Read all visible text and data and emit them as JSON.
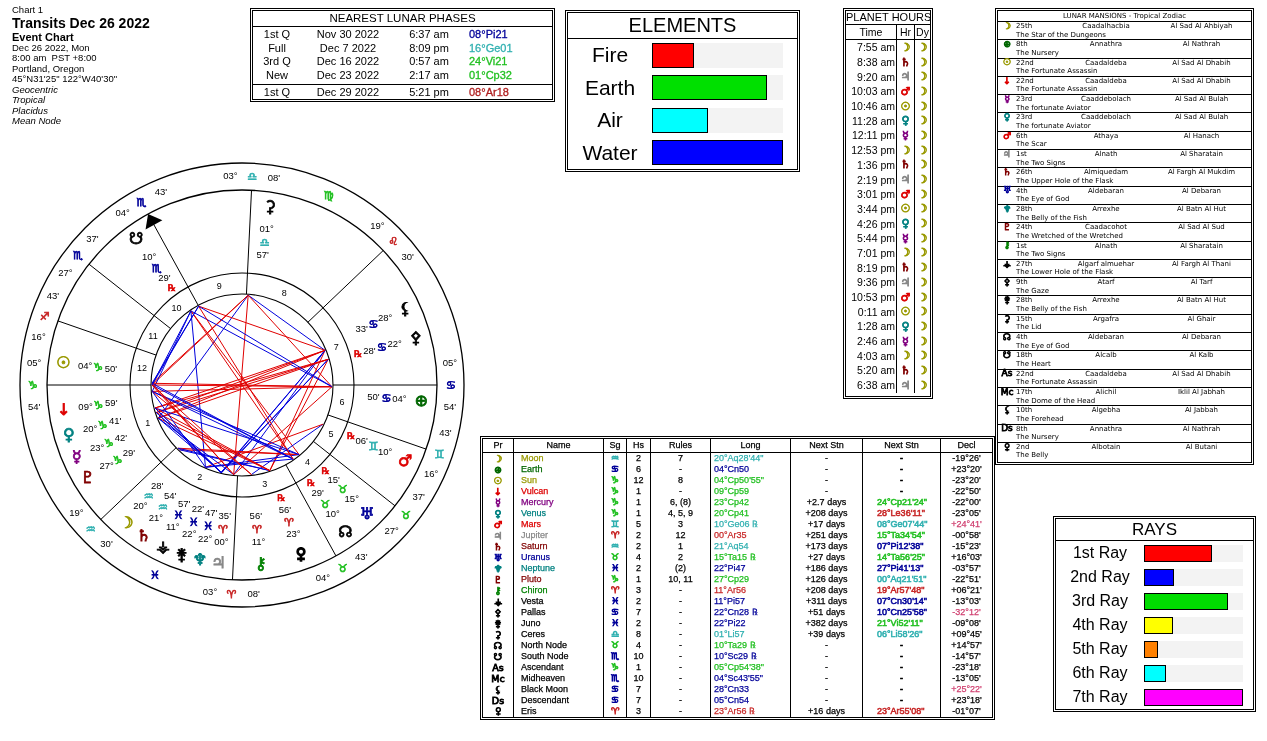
{
  "chart_info": {
    "label": "Chart 1",
    "title": "Transits Dec 26 2022",
    "subtitle": "Event Chart",
    "details": [
      "Dec 26 2022, Mon",
      "8:00 am  PST +8:00",
      "Portland, Oregon",
      "45°N31'25\" 122°W40'30\""
    ],
    "settings": [
      "Geocentric",
      "Tropical",
      "Placidus",
      "Mean Node"
    ]
  },
  "lunar_phases": {
    "title": "NEAREST LUNAR PHASES",
    "phases": [
      {
        "phase": "1st Q",
        "date": "Nov 30 2022",
        "time": "6:37 am",
        "position": "08°Pi21",
        "color": "#000099"
      },
      {
        "phase": "Full",
        "date": "Dec 7 2022",
        "time": "8:09 pm",
        "position": "16°Ge01",
        "color": "#30b0b0"
      },
      {
        "phase": "3rd Q",
        "date": "Dec 16 2022",
        "time": "0:57 am",
        "position": "24°Vi21",
        "color": "#22c022"
      },
      {
        "phase": "New",
        "date": "Dec 23 2022",
        "time": "2:17 am",
        "position": "01°Cp32",
        "color": "#22c022"
      }
    ],
    "next_phase": {
      "phase": "1st Q",
      "date": "Dec 29 2022",
      "time": "5:21 pm",
      "position": "08°Ar18",
      "color": "#b02020"
    }
  },
  "elements": {
    "title": "ELEMENTS",
    "items": [
      {
        "label": "Fire",
        "level": 0.32,
        "color": "#ff0000"
      },
      {
        "label": "Earth",
        "level": 0.88,
        "color": "#00e000"
      },
      {
        "label": "Air",
        "level": 0.43,
        "color": "#00ffff"
      },
      {
        "label": "Water",
        "level": 1,
        "color": "#0000ff"
      }
    ]
  },
  "planet_hours": {
    "title": "PLANET HOURS",
    "columns": [
      "Time",
      "Hr",
      "Dy"
    ],
    "rows": [
      {
        "time": "7:55 am",
        "symbol": "☽",
        "color": "#999900",
        "day_symbol": "☽"
      },
      {
        "time": "8:38 am",
        "symbol": "♄",
        "color": "#800000",
        "day_symbol": "☽"
      },
      {
        "time": "9:20 am",
        "symbol": "♃",
        "color": "#888888",
        "day_symbol": "☽"
      },
      {
        "time": "10:03 am",
        "symbol": "♂",
        "color": "#dd0000",
        "day_symbol": "☽"
      },
      {
        "time": "10:46 am",
        "symbol": "☉",
        "color": "#999900",
        "day_symbol": "☽"
      },
      {
        "time": "11:28 am",
        "symbol": "♀",
        "color": "#008080",
        "day_symbol": "☽"
      },
      {
        "time": "12:11 pm",
        "symbol": "☿",
        "color": "#800080",
        "day_symbol": "☽"
      },
      {
        "time": "12:53 pm",
        "symbol": "☽",
        "color": "#999900",
        "day_symbol": "☽"
      },
      {
        "time": "1:36 pm",
        "symbol": "♄",
        "color": "#800000",
        "day_symbol": "☽"
      },
      {
        "time": "2:19 pm",
        "symbol": "♃",
        "color": "#888888",
        "day_symbol": "☽"
      },
      {
        "time": "3:01 pm",
        "symbol": "♂",
        "color": "#dd0000",
        "day_symbol": "☽"
      },
      {
        "time": "3:44 pm",
        "symbol": "☉",
        "color": "#999900",
        "day_symbol": "☽"
      },
      {
        "time": "4:26 pm",
        "symbol": "♀",
        "color": "#008080",
        "day_symbol": "☽"
      },
      {
        "time": "5:44 pm",
        "symbol": "☿",
        "color": "#800080",
        "day_symbol": "☽"
      },
      {
        "time": "7:01 pm",
        "symbol": "☽",
        "color": "#999900",
        "day_symbol": "☽"
      },
      {
        "time": "8:19 pm",
        "symbol": "♄",
        "color": "#800000",
        "day_symbol": "☽"
      },
      {
        "time": "9:36 pm",
        "symbol": "♃",
        "color": "#888888",
        "day_symbol": "☽"
      },
      {
        "time": "10:53 pm",
        "symbol": "♂",
        "color": "#dd0000",
        "day_symbol": "☽"
      },
      {
        "time": "0:11 am",
        "symbol": "☉",
        "color": "#999900",
        "day_symbol": "☽"
      },
      {
        "time": "1:28 am",
        "symbol": "♀",
        "color": "#008080",
        "day_symbol": "☽"
      },
      {
        "time": "2:46 am",
        "symbol": "☿",
        "color": "#800080",
        "day_symbol": "☽"
      },
      {
        "time": "4:03 am",
        "symbol": "☽",
        "color": "#999900",
        "day_symbol": "☽"
      },
      {
        "time": "5:20 am",
        "symbol": "♄",
        "color": "#800000",
        "day_symbol": "☽"
      },
      {
        "time": "6:38 am",
        "symbol": "♃",
        "color": "#888888",
        "day_symbol": "☽"
      }
    ]
  },
  "lunar_mansions": {
    "title": "LUNAR MANSIONS - Tropical Zodiac",
    "rows": [
      {
        "symbol": "☽",
        "color": "#999900",
        "number": "25th",
        "name": "Caadalhacbia",
        "arabic": "Al Sad Al Ahbiyah",
        "meaning": "The Star of the Dungeons"
      },
      {
        "symbol": "⊕",
        "color": "#006600",
        "number": "8th",
        "name": "Annathra",
        "arabic": "Al Nathrah",
        "meaning": "The Nursery"
      },
      {
        "symbol": "☉",
        "color": "#999900",
        "number": "22nd",
        "name": "Caadaldeba",
        "arabic": "Al Sad Al Dhabih",
        "meaning": "The Fortunate Assassin"
      },
      {
        "symbol": "↓",
        "color": "#dd0000",
        "number": "22nd",
        "name": "Caadaldeba",
        "arabic": "Al Sad Al Dhabih",
        "meaning": "The Fortunate Assassin"
      },
      {
        "symbol": "☿",
        "color": "#800080",
        "number": "23rd",
        "name": "Caaddebolach",
        "arabic": "Al Sad Al Bulah",
        "meaning": "The fortunate Aviator"
      },
      {
        "symbol": "♀",
        "color": "#008080",
        "number": "23rd",
        "name": "Caaddebolach",
        "arabic": "Al Sad Al Bulah",
        "meaning": "The fortunate Aviator"
      },
      {
        "symbol": "♂",
        "color": "#dd0000",
        "number": "6th",
        "name": "Athaya",
        "arabic": "Al Hanach",
        "meaning": "The Scar"
      },
      {
        "symbol": "♃",
        "color": "#888888",
        "number": "1st",
        "name": "Alnath",
        "arabic": "Al Sharatain",
        "meaning": "The Two Signs"
      },
      {
        "symbol": "♄",
        "color": "#800000",
        "number": "26th",
        "name": "Almiquedam",
        "arabic": "Al Fargh Al Mukdim",
        "meaning": "The Upper Hole of the Flask"
      },
      {
        "symbol": "♅",
        "color": "#000099",
        "number": "4th",
        "name": "Aldebaran",
        "arabic": "Al Debaran",
        "meaning": "The Eye of God"
      },
      {
        "symbol": "♆",
        "color": "#008080",
        "number": "28th",
        "name": "Arrexhe",
        "arabic": "Al Batn Al Hut",
        "meaning": "The Belly of the Fish"
      },
      {
        "symbol": "♇",
        "color": "#800000",
        "number": "24th",
        "name": "Caadacohot",
        "arabic": "Al Sad Al Sud",
        "meaning": "The Wretched of the Wretched"
      },
      {
        "symbol": "⚷",
        "color": "#008000",
        "number": "1st",
        "name": "Alnath",
        "arabic": "Al Sharatain",
        "meaning": "The Two Signs"
      },
      {
        "symbol": "⚶",
        "color": "#000000",
        "number": "27th",
        "name": "Algarf almuehar",
        "arabic": "Al Fargh Al Thani",
        "meaning": "The Lower Hole of the Flask"
      },
      {
        "symbol": "⚴",
        "color": "#000000",
        "number": "9th",
        "name": "Atarf",
        "arabic": "Al Tarf",
        "meaning": "The Gaze"
      },
      {
        "symbol": "⚵",
        "color": "#000000",
        "number": "28th",
        "name": "Arrexhe",
        "arabic": "Al Batn Al Hut",
        "meaning": "The Belly of the Fish"
      },
      {
        "symbol": "⚳",
        "color": "#000000",
        "number": "15th",
        "name": "Argafra",
        "arabic": "Al Ghair",
        "meaning": "The Lid"
      },
      {
        "symbol": "☊",
        "color": "#000000",
        "number": "4th",
        "name": "Aldebaran",
        "arabic": "Al Debaran",
        "meaning": "The Eye of God"
      },
      {
        "symbol": "☋",
        "color": "#000000",
        "number": "18th",
        "name": "Alcalb",
        "arabic": "Al Kalb",
        "meaning": "The Heart"
      },
      {
        "symbol": "As",
        "color": "#000000",
        "number": "22nd",
        "name": "Caadaldeba",
        "arabic": "Al Sad Al Dhabih",
        "meaning": "The Fortunate Assassin"
      },
      {
        "symbol": "Mc",
        "color": "#000000",
        "number": "17th",
        "name": "Alichil",
        "arabic": "Iklil Al Jabhah",
        "meaning": "The Dome of the Head"
      },
      {
        "symbol": "⚸",
        "color": "#000000",
        "number": "10th",
        "name": "Algebha",
        "arabic": "Al Jabbah",
        "meaning": "The Forehead"
      },
      {
        "symbol": "Ds",
        "color": "#000000",
        "number": "8th",
        "name": "Annathra",
        "arabic": "Al Nathrah",
        "meaning": "The Nursery"
      },
      {
        "color": "#000000",
        "number": "2nd",
        "name": "Albotain",
        "arabic": "Al Butani",
        "meaning": "The Belly"
      }
    ]
  },
  "wheel": {
    "cusps": [
      {
        "degree": "05°",
        "sign": "♑",
        "color": "#22c022",
        "minutes": "54'"
      },
      {
        "degree": "19°",
        "sign": "♒",
        "color": "#30b0b0",
        "minutes": "30'"
      },
      {
        "degree": "03°",
        "sign": "♈",
        "color": "#c82828",
        "minutes": "08'"
      },
      {
        "degree": "04°",
        "sign": "♉",
        "color": "#22c022",
        "minutes": "43'"
      },
      {
        "degree": "27°",
        "sign": "♉",
        "color": "#22c022",
        "minutes": "37'"
      },
      {
        "degree": "16°",
        "sign": "♊",
        "color": "#30b0b0",
        "minutes": "43'"
      },
      {
        "degree": "05°",
        "sign": "♋",
        "color": "#000099",
        "minutes": "54'"
      },
      {
        "degree": "19°",
        "sign": "♌",
        "color": "#c82828",
        "minutes": "30'"
      },
      {
        "degree": "03°",
        "sign": "♎",
        "color": "#30b0b0",
        "minutes": "08'"
      },
      {
        "degree": "04°",
        "sign": "♏",
        "color": "#000099",
        "minutes": "43'"
      },
      {
        "degree": "27°",
        "sign": "♏",
        "color": "#000099",
        "minutes": "37'"
      },
      {
        "degree": "16°",
        "sign": "♐",
        "color": "#c82828",
        "minutes": "43'"
      }
    ],
    "intercepted_signs": [
      {
        "sign": "♍",
        "color": "#22c022"
      },
      {
        "sign": "♓",
        "color": "#000099"
      }
    ],
    "house_numbers": [
      "1",
      "2",
      "3",
      "4",
      "5",
      "6",
      "7",
      "8",
      "9",
      "10",
      "11",
      "12"
    ],
    "planets": [
      {
        "symbol": "☋",
        "color": "#000000",
        "degree": "10°",
        "sign": {
          "glyph": "♏",
          "color": "#000099"
        },
        "minutes": "29'",
        "retrograde": "℞"
      },
      {
        "symbol": "⚳",
        "color": "#000000",
        "degree": "01°",
        "sign": {
          "glyph": "♎",
          "color": "#30b0b0"
        },
        "minutes": "57'"
      },
      {
        "symbol": "⚸",
        "color": "#000000",
        "degree": "28°",
        "sign": {
          "glyph": "♋",
          "color": "#000099"
        },
        "minutes": "33'"
      },
      {
        "symbol": "⚴",
        "color": "#000000",
        "degree": "22°",
        "sign": {
          "glyph": "♋",
          "color": "#000099"
        },
        "minutes": "28'",
        "retrograde": "℞"
      },
      {
        "symbol": "☉",
        "color": "#999900",
        "degree": "04°",
        "sign": {
          "glyph": "♑",
          "color": "#22c022"
        },
        "minutes": "50'"
      },
      {
        "symbol": "↓",
        "color": "#dd0000",
        "degree": "09°",
        "sign": {
          "glyph": "♑",
          "color": "#22c022"
        },
        "minutes": "59'"
      },
      {
        "symbol": "⊕",
        "color": "#006600",
        "degree": "04°",
        "sign": {
          "glyph": "♋",
          "color": "#000099"
        },
        "minutes": "50'"
      },
      {
        "symbol": "♀",
        "color": "#008080",
        "degree": "20°",
        "sign": {
          "glyph": "♑",
          "color": "#22c022"
        },
        "minutes": "41'"
      },
      {
        "symbol": "☿",
        "color": "#800080",
        "degree": "23°",
        "sign": {
          "glyph": "♑",
          "color": "#22c022"
        },
        "minutes": "42'"
      },
      {
        "symbol": "♇",
        "color": "#800000",
        "degree": "27°",
        "sign": {
          "glyph": "♑",
          "color": "#22c022"
        },
        "minutes": "29'"
      },
      {
        "symbol": "♂",
        "color": "#dd0000",
        "degree": "10°",
        "sign": {
          "glyph": "♊",
          "color": "#30b0b0"
        },
        "minutes": "06'",
        "retrograde": "℞"
      },
      {
        "symbol": "☽",
        "color": "#999900",
        "degree": "20°",
        "sign": {
          "glyph": "♒",
          "color": "#30b0b0"
        },
        "minutes": "28'"
      },
      {
        "symbol": "♄",
        "color": "#800000",
        "degree": "21°",
        "sign": {
          "glyph": "♒",
          "color": "#30b0b0"
        },
        "minutes": "54'"
      },
      {
        "symbol": "⚶",
        "color": "#000000",
        "degree": "11°",
        "sign": {
          "glyph": "♓",
          "color": "#000099"
        },
        "minutes": "57'"
      },
      {
        "symbol": "⚵",
        "color": "#000000",
        "degree": "22°",
        "sign": {
          "glyph": "♓",
          "color": "#000099"
        },
        "minutes": "22'"
      },
      {
        "symbol": "♆",
        "color": "#008080",
        "degree": "22°",
        "sign": {
          "glyph": "♓",
          "color": "#000099"
        },
        "minutes": "47'"
      },
      {
        "symbol": "♃",
        "color": "#888888",
        "degree": "00°",
        "sign": {
          "glyph": "♈",
          "color": "#c82828"
        },
        "minutes": "35'"
      },
      {
        "symbol": "⚷",
        "color": "#008000",
        "degree": "11°",
        "sign": {
          "glyph": "♈",
          "color": "#c82828"
        },
        "minutes": "56'"
      },
      {
        "color": "#000000",
        "degree": "23°",
        "sign": {
          "glyph": "♈",
          "color": "#c82828"
        },
        "minutes": "56'",
        "retrograde": "℞"
      },
      {
        "symbol": "☊",
        "color": "#000000",
        "degree": "10°",
        "sign": {
          "glyph": "♉",
          "color": "#22c022"
        },
        "minutes": "29'",
        "retrograde": "℞"
      },
      {
        "symbol": "♅",
        "color": "#000099",
        "degree": "15°",
        "sign": {
          "glyph": "♉",
          "color": "#22c022"
        },
        "minutes": "15'",
        "retrograde": "℞"
      }
    ]
  },
  "planets_table": {
    "columns": [
      "Pr",
      "Name",
      "Sg",
      "Hs",
      "Rules",
      "Long",
      "Next Stn",
      "Next Stn",
      "Decl"
    ],
    "rows": [
      {
        "symbol": "☽",
        "name": "Moon",
        "color": "#999900",
        "sign": {
          "glyph": "♒",
          "color": "#30b0b0"
        },
        "house": "2",
        "rules": "7",
        "longitude": "20°Aq28'44\"",
        "station_time": "-",
        "station_position": {
          "text": "-"
        },
        "declination": "-19°26'",
        "out_of_bounds": false
      },
      {
        "symbol": "⊕",
        "name": "Earth",
        "color": "#006600",
        "sign": {
          "glyph": "♋",
          "color": "#000099"
        },
        "house": "6",
        "rules": "-",
        "longitude": "04°Cn50",
        "station_time": "-",
        "station_position": {
          "text": "-"
        },
        "declination": "+23°20'",
        "out_of_bounds": false
      },
      {
        "symbol": "☉",
        "name": "Sun",
        "color": "#999900",
        "sign": {
          "glyph": "♑",
          "color": "#22c022"
        },
        "house": "12",
        "rules": "8",
        "longitude": "04°Cp50'55\"",
        "station_time": "-",
        "station_position": {
          "text": "-"
        },
        "declination": "-23°20'",
        "out_of_bounds": false
      },
      {
        "symbol": "↓",
        "name": "Vulcan",
        "color": "#dd0000",
        "sign": {
          "glyph": "♑",
          "color": "#22c022"
        },
        "house": "1",
        "rules": "-",
        "longitude": "09°Cp59",
        "station_time": "-",
        "station_position": {
          "text": "-"
        },
        "declination": "-22°50'",
        "out_of_bounds": false
      },
      {
        "symbol": "☿",
        "name": "Mercury",
        "color": "#800080",
        "sign": {
          "glyph": "♑",
          "color": "#22c022"
        },
        "house": "1",
        "rules": "6, (8)",
        "longitude": "23°Cp42",
        "station_time": "+2.7 days",
        "station_position": {
          "text": "24°Cp21'24\"",
          "color": "#22c022"
        },
        "declination": "-22°00'",
        "out_of_bounds": false
      },
      {
        "symbol": "♀",
        "name": "Venus",
        "color": "#008080",
        "sign": {
          "glyph": "♑",
          "color": "#22c022"
        },
        "house": "1",
        "rules": "4, 5, 9",
        "longitude": "20°Cp41",
        "station_time": "+208 days",
        "station_position": {
          "text": "28°Le36'11\"",
          "color": "#c82828"
        },
        "declination": "-23°05'",
        "out_of_bounds": false
      },
      {
        "symbol": "♂",
        "name": "Mars",
        "color": "#dd0000",
        "sign": {
          "glyph": "♊",
          "color": "#30b0b0"
        },
        "house": "5",
        "rules": "3",
        "longitude": "10°Ge06 ℞",
        "station_time": "+17 days",
        "station_position": {
          "text": "08°Ge07'44\"",
          "color": "#30b0b0"
        },
        "declination": "+24°41'",
        "out_of_bounds": true
      },
      {
        "symbol": "♃",
        "name": "Jupiter",
        "color": "#888888",
        "sign": {
          "glyph": "♈",
          "color": "#c82828"
        },
        "house": "2",
        "rules": "12",
        "longitude": "00°Ar35",
        "station_time": "+251 days",
        "station_position": {
          "text": "15°Ta34'54\"",
          "color": "#22c022"
        },
        "declination": "-00°58'",
        "out_of_bounds": false
      },
      {
        "symbol": "♄",
        "name": "Saturn",
        "color": "#800000",
        "sign": {
          "glyph": "♒",
          "color": "#30b0b0"
        },
        "house": "2",
        "rules": "1",
        "longitude": "21°Aq54",
        "station_time": "+173 days",
        "station_position": {
          "text": "07°Pi12'38\"",
          "color": "#000099"
        },
        "declination": "-15°23'",
        "out_of_bounds": false
      },
      {
        "symbol": "♅",
        "name": "Uranus",
        "color": "#000099",
        "sign": {
          "glyph": "♉",
          "color": "#22c022"
        },
        "house": "4",
        "rules": "2",
        "longitude": "15°Ta15 ℞",
        "station_time": "+27 days",
        "station_position": {
          "text": "14°Ta56'25\"",
          "color": "#22c022"
        },
        "declination": "+16°03'",
        "out_of_bounds": false
      },
      {
        "symbol": "♆",
        "name": "Neptune",
        "color": "#008080",
        "sign": {
          "glyph": "♓",
          "color": "#000099"
        },
        "house": "2",
        "rules": "(2)",
        "longitude": "22°Pi47",
        "station_time": "+186 days",
        "station_position": {
          "text": "27°Pi41'13\"",
          "color": "#000099"
        },
        "declination": "-03°57'",
        "out_of_bounds": false
      },
      {
        "symbol": "♇",
        "name": "Pluto",
        "color": "#800000",
        "sign": {
          "glyph": "♑",
          "color": "#22c022"
        },
        "house": "1",
        "rules": "10, 11",
        "longitude": "27°Cp29",
        "station_time": "+126 days",
        "station_position": {
          "text": "00°Aq21'51\"",
          "color": "#30b0b0"
        },
        "declination": "-22°51'",
        "out_of_bounds": false
      },
      {
        "symbol": "⚷",
        "name": "Chiron",
        "color": "#008000",
        "sign": {
          "glyph": "♈",
          "color": "#c82828"
        },
        "house": "3",
        "rules": "-",
        "longitude": "11°Ar56",
        "station_time": "+208 days",
        "station_position": {
          "text": "19°Ar57'48\"",
          "color": "#c82828"
        },
        "declination": "+06°21'",
        "out_of_bounds": false
      },
      {
        "symbol": "⚶",
        "name": "Vesta",
        "color": "#000000",
        "sign": {
          "glyph": "♓",
          "color": "#000099"
        },
        "house": "2",
        "rules": "-",
        "longitude": "11°Pi57",
        "station_time": "+311 days",
        "station_position": {
          "text": "07°Cn30'14\"",
          "color": "#000099"
        },
        "declination": "-13°03'",
        "out_of_bounds": false
      },
      {
        "symbol": "⚴",
        "name": "Pallas",
        "color": "#000000",
        "sign": {
          "glyph": "♋",
          "color": "#000099"
        },
        "house": "7",
        "rules": "-",
        "longitude": "22°Cn28 ℞",
        "station_time": "+51 days",
        "station_position": {
          "text": "10°Cn25'58\"",
          "color": "#000099"
        },
        "declination": "-32°12'",
        "out_of_bounds": true
      },
      {
        "symbol": "⚵",
        "name": "Juno",
        "color": "#000000",
        "sign": {
          "glyph": "♓",
          "color": "#000099"
        },
        "house": "2",
        "rules": "-",
        "longitude": "22°Pi22",
        "station_time": "+382 days",
        "station_position": {
          "text": "21°Vi52'11\"",
          "color": "#22c022"
        },
        "declination": "-09°08'",
        "out_of_bounds": false
      },
      {
        "symbol": "⚳",
        "name": "Ceres",
        "color": "#000000",
        "sign": {
          "glyph": "♎",
          "color": "#30b0b0"
        },
        "house": "8",
        "rules": "-",
        "longitude": "01°Li57",
        "station_time": "+39 days",
        "station_position": {
          "text": "06°Li58'26\"",
          "color": "#30b0b0"
        },
        "declination": "+09°45'",
        "out_of_bounds": false
      },
      {
        "symbol": "☊",
        "name": "North Node",
        "color": "#000000",
        "sign": {
          "glyph": "♉",
          "color": "#22c022"
        },
        "house": "4",
        "rules": "-",
        "longitude": "10°Ta29 ℞",
        "station_time": "-",
        "station_position": {
          "text": "-"
        },
        "declination": "+14°57'",
        "out_of_bounds": false
      },
      {
        "symbol": "☋",
        "name": "South Node",
        "color": "#000000",
        "sign": {
          "glyph": "♏",
          "color": "#000099"
        },
        "house": "10",
        "rules": "-",
        "longitude": "10°Sc29 ℞",
        "station_time": "-",
        "station_position": {
          "text": "-"
        },
        "declination": "-14°57'",
        "out_of_bounds": false
      },
      {
        "symbol": "As",
        "name": "Ascendant",
        "color": "#000000",
        "sign": {
          "glyph": "♑",
          "color": "#22c022"
        },
        "house": "1",
        "rules": "-",
        "longitude": "05°Cp54'38\"",
        "station_time": "-",
        "station_position": {
          "text": "-"
        },
        "declination": "-23°18'",
        "out_of_bounds": false
      },
      {
        "symbol": "Mc",
        "name": "Midheaven",
        "color": "#000000",
        "sign": {
          "glyph": "♏",
          "color": "#000099"
        },
        "house": "10",
        "rules": "-",
        "longitude": "04°Sc43'55\"",
        "station_time": "-",
        "station_position": {
          "text": "-"
        },
        "declination": "-13°05'",
        "out_of_bounds": false
      },
      {
        "symbol": "⚸",
        "name": "Black Moon",
        "color": "#000000",
        "sign": {
          "glyph": "♋",
          "color": "#000099"
        },
        "house": "7",
        "rules": "-",
        "longitude": "28°Cn33",
        "station_time": "-",
        "station_position": {
          "text": "-"
        },
        "declination": "+25°22'",
        "out_of_bounds": true
      },
      {
        "symbol": "Ds",
        "name": "Descendant",
        "color": "#000000",
        "sign": {
          "glyph": "♋",
          "color": "#000099"
        },
        "house": "7",
        "rules": "-",
        "longitude": "05°Cn54",
        "station_time": "-",
        "station_position": {
          "text": "-"
        },
        "declination": "+23°18'",
        "out_of_bounds": false
      },
      {
        "name": "Eris",
        "color": "#000000",
        "sign": {
          "glyph": "♈",
          "color": "#c82828"
        },
        "house": "3",
        "rules": "-",
        "longitude": "23°Ar56 ℞",
        "station_time": "+16 days",
        "station_position": {
          "text": "23°Ar55'08\"",
          "color": "#c82828"
        },
        "declination": "-01°07'",
        "out_of_bounds": false
      }
    ]
  },
  "rays": {
    "title": "RAYS",
    "items": [
      {
        "label": "1st Ray",
        "level": 0.69,
        "color": "#ff0000"
      },
      {
        "label": "2nd Ray",
        "level": 0.3,
        "color": "#0000ff"
      },
      {
        "label": "3rd Ray",
        "level": 0.85,
        "color": "#00dd00"
      },
      {
        "label": "4th Ray",
        "level": 0.29,
        "color": "#ffff00"
      },
      {
        "label": "5th Ray",
        "level": 0.14,
        "color": "#ff8000"
      },
      {
        "label": "6th Ray",
        "level": 0.22,
        "color": "#00ffff"
      },
      {
        "label": "7th Ray",
        "level": 1,
        "color": "#ff00ff"
      }
    ]
  }
}
